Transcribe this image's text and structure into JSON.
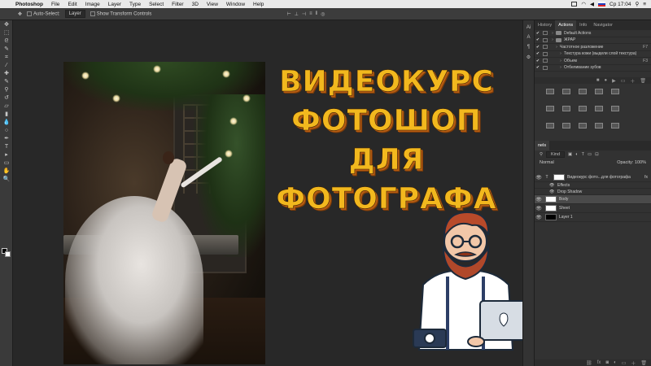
{
  "menubar": {
    "app": "Photoshop",
    "items": [
      "File",
      "Edit",
      "Image",
      "Layer",
      "Type",
      "Select",
      "Filter",
      "3D",
      "View",
      "Window",
      "Help"
    ],
    "clock": "Ср 17:04"
  },
  "options": {
    "auto_select": "Auto-Select:",
    "auto_select_target": "Layer",
    "show_transform": "Show Transform Controls"
  },
  "toolbar": {
    "icons": [
      "move-icon",
      "marquee-icon",
      "lasso-icon",
      "quick-select-icon",
      "crop-icon",
      "eyedropper-icon",
      "healing-icon",
      "brush-icon",
      "stamp-icon",
      "history-brush-icon",
      "eraser-icon",
      "gradient-icon",
      "blur-icon",
      "dodge-icon",
      "pen-icon",
      "type-icon",
      "path-select-icon",
      "shape-icon",
      "hand-icon",
      "zoom-icon"
    ],
    "glyphs": [
      "✥",
      "⬚",
      "ᘓ",
      "✎",
      "⌗",
      "⁄",
      "✚",
      "✎",
      "⚲",
      "↺",
      "▱",
      "▮",
      "💧",
      "○",
      "✒",
      "T",
      "▸",
      "▭",
      "✋",
      "🔍"
    ]
  },
  "title": {
    "lines": [
      "ВИДЕОКУРС",
      "ФОТОШОП",
      "ДЛЯ ФОТОГРАФА"
    ]
  },
  "panel_strip": {
    "labels": [
      "Ai",
      "A",
      "¶",
      "⚙"
    ]
  },
  "actions_panel": {
    "tabs": [
      "History",
      "Actions",
      "Info",
      "Navigator"
    ],
    "active_tab": "Actions",
    "rows": [
      {
        "label": "Default Actions",
        "fkey": "",
        "indent": 0,
        "folder": true
      },
      {
        "label": "ЖРАР",
        "fkey": "",
        "indent": 0,
        "folder": true
      },
      {
        "label": "Частотное разложение",
        "fkey": "F7",
        "indent": 1,
        "folder": false
      },
      {
        "label": "Текстура кожи (выдели слой текстура)",
        "fkey": "",
        "indent": 2,
        "folder": false
      },
      {
        "label": "Объем",
        "fkey": "F3",
        "indent": 2,
        "folder": false
      },
      {
        "label": "Отбеливание зубов",
        "fkey": "",
        "indent": 2,
        "folder": false
      }
    ]
  },
  "layers_panel": {
    "tab_suffix": "nels",
    "filter_kind": "Kind",
    "blend_mode": "Normal",
    "opacity": "Opacity: 100%",
    "layers": [
      {
        "name": "Видеокурс фото...для фотографа",
        "type": "text",
        "selected": false,
        "fx": "fx"
      },
      {
        "name": "Effects",
        "type": "sub",
        "selected": false,
        "fx": ""
      },
      {
        "name": "Drop Shadow",
        "type": "sub",
        "selected": false,
        "fx": ""
      },
      {
        "name": "Body",
        "type": "image",
        "selected": true,
        "fx": ""
      },
      {
        "name": "Sheet",
        "type": "image",
        "selected": false,
        "fx": ""
      },
      {
        "name": "Layer 1",
        "type": "dark",
        "selected": false,
        "fx": ""
      }
    ]
  },
  "colors": {
    "title_fill": "#f2b81e",
    "title_shadow": "#b55c12",
    "canvas_bg": "#282828",
    "panel_bg": "#323232"
  }
}
